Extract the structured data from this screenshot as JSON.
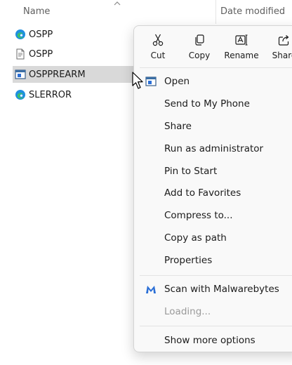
{
  "columns": {
    "name": "Name",
    "date_modified": "Date modified"
  },
  "files": [
    {
      "label": "OSPP",
      "icon": "edge-icon"
    },
    {
      "label": "OSPP",
      "icon": "document-icon"
    },
    {
      "label": "OSPPREARM",
      "icon": "window-app-icon",
      "selected": true
    },
    {
      "label": "SLERROR",
      "icon": "edge-icon"
    }
  ],
  "toolbar": {
    "cut": "Cut",
    "copy": "Copy",
    "rename": "Rename",
    "share": "Share"
  },
  "menu": {
    "open": "Open",
    "send_to_phone": "Send to My Phone",
    "share": "Share",
    "run_as_admin": "Run as administrator",
    "pin_to_start": "Pin to Start",
    "add_to_favorites": "Add to Favorites",
    "compress_to": "Compress to...",
    "copy_as_path": "Copy as path",
    "properties": "Properties",
    "scan_malwarebytes": "Scan with Malwarebytes",
    "loading": "Loading...",
    "show_more": "Show more options"
  },
  "colors": {
    "accent": "#0067c0",
    "malwarebytes": "#2b6fd6",
    "selection": "#d9d9d9"
  }
}
